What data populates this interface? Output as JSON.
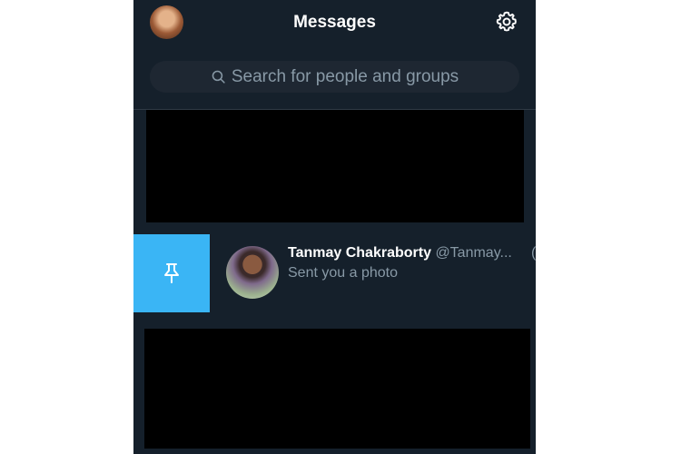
{
  "header": {
    "title": "Messages",
    "profile_avatar_icon": "profile-avatar",
    "settings_icon": "gear-icon"
  },
  "search": {
    "placeholder": "Search for people and groups",
    "icon": "search-icon"
  },
  "conversations": [
    {
      "name": "Tanmay Chakraborty",
      "handle": "@Tanmay...",
      "extra": "(",
      "preview": "Sent you a photo",
      "swipe_action_icon": "pin-icon"
    }
  ],
  "colors": {
    "background": "#15202b",
    "search_bg": "#1e2732",
    "pin_action": "#3ab5f5",
    "muted_text": "#8899a6"
  }
}
